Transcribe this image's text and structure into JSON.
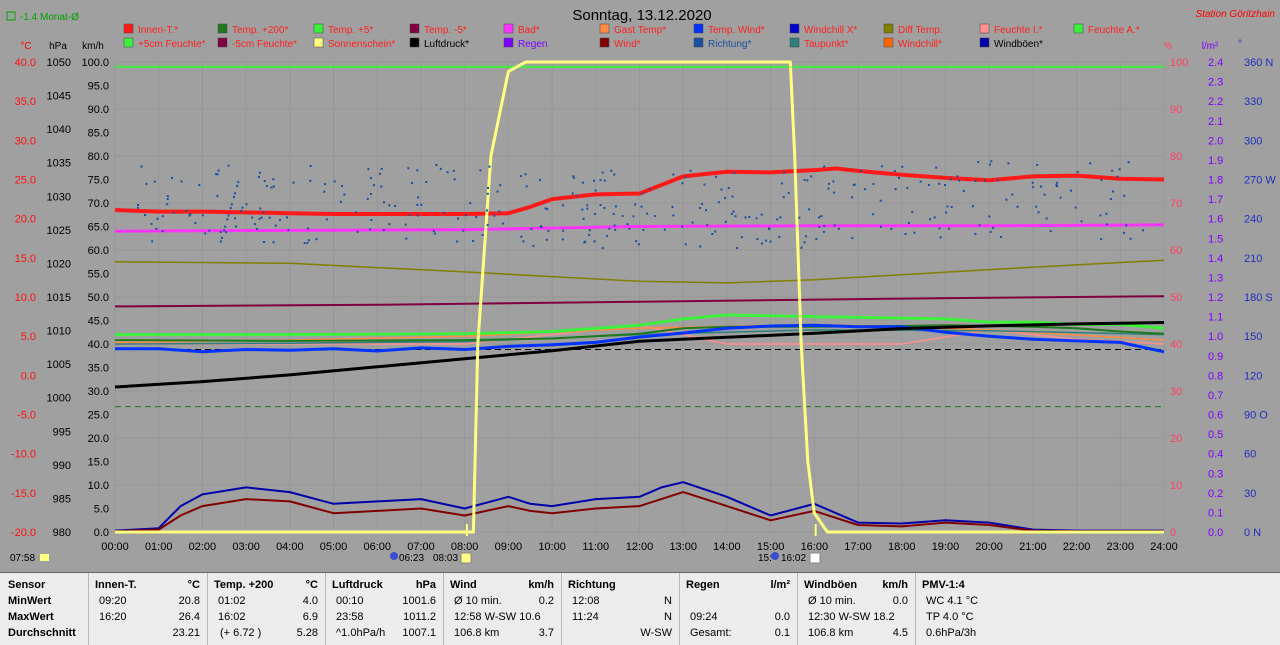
{
  "header": {
    "avg_label": "-1.4 Monat-Ø",
    "title": "Sonntag, 13.12.2020",
    "station": "Station Göritzhain"
  },
  "colors": {
    "plot_bg": "#a0a0a0",
    "innen_t": "#ff1a1a",
    "temp200": "#1f7a1f",
    "temp5": "#3cf03c",
    "temp_m5": "#800040",
    "bad": "#ff33ff",
    "gast": "#ff8c40",
    "temp_wind": "#0033ff",
    "windchill_x": "#0000cc",
    "diff_temp": "#808000",
    "feuchte_i": "#ff9090",
    "feuchte_a": "#3cf03c",
    "sonnenschein": "#ffff80",
    "luftdruck": "#000000",
    "regen": "#8000ff",
    "wind": "#800000",
    "richtung": "#1a4fa0",
    "taupunkt": "#2f7f7f",
    "windchill": "#ff6600",
    "windboeen": "#0000aa"
  },
  "legend": [
    {
      "label": "Innen-T.*",
      "color": "#ff1a1a",
      "text_color": "#ff2020"
    },
    {
      "label": "Temp. +200*",
      "color": "#1f7a1f",
      "text_color": "#ff2020"
    },
    {
      "label": "Temp. +5*",
      "color": "#3cf03c",
      "text_color": "#ff2020"
    },
    {
      "label": "Temp. -5*",
      "color": "#800040",
      "text_color": "#ff2020"
    },
    {
      "label": "Bad*",
      "color": "#ff33ff",
      "text_color": "#ff2020"
    },
    {
      "label": "Gast Temp*",
      "color": "#ff8c40",
      "text_color": "#ff2020"
    },
    {
      "label": "Temp. Wind*",
      "color": "#0033ff",
      "text_color": "#ff2020"
    },
    {
      "label": "Windchill X*",
      "color": "#0000cc",
      "text_color": "#ff2020"
    },
    {
      "label": "Diff Temp.",
      "color": "#808000",
      "text_color": "#ff2020"
    },
    {
      "label": "Feuchte I.*",
      "color": "#ff9090",
      "text_color": "#ff2020"
    },
    {
      "label": "Feuchte A.*",
      "color": "#3cf03c",
      "text_color": "#ff2020"
    },
    {
      "label": "+5cm Feuchte*",
      "color": "#3cf03c",
      "text_color": "#ff2020"
    },
    {
      "label": "-5cm Feuchte*",
      "color": "#800040",
      "text_color": "#ff2020"
    },
    {
      "label": "Sonnenschein*",
      "color": "#ffff80",
      "text_color": "#ff2020"
    },
    {
      "label": "Luftdruck*",
      "color": "#000000",
      "text_color": "#000000"
    },
    {
      "label": "Regen",
      "color": "#8000ff",
      "text_color": "#8000ff"
    },
    {
      "label": "Wind*",
      "color": "#800000",
      "text_color": "#ff2020"
    },
    {
      "label": "Richtung*",
      "color": "#1a4fa0",
      "text_color": "#1a4fa0"
    },
    {
      "label": "Taupunkt*",
      "color": "#2f7f7f",
      "text_color": "#ff2020"
    },
    {
      "label": "Windchill*",
      "color": "#ff6600",
      "text_color": "#ff2020"
    },
    {
      "label": "Windböen*",
      "color": "#0000aa",
      "text_color": "#000000"
    }
  ],
  "chart_data": {
    "type": "line",
    "axes": {
      "temp": {
        "unit": "°C",
        "ticks": [
          "40.0",
          "35.0",
          "30.0",
          "25.0",
          "20.0",
          "15.0",
          "10.0",
          "5.0",
          "0.0",
          "-5.0",
          "-10.0",
          "-15.0",
          "-20.0"
        ],
        "min": -20,
        "max": 40
      },
      "pressure": {
        "unit": "hPa",
        "ticks": [
          "1050",
          "1045",
          "1040",
          "1035",
          "1030",
          "1025",
          "1020",
          "1015",
          "1010",
          "1005",
          "1000",
          "995",
          "990",
          "985",
          "980"
        ],
        "min": 980,
        "max": 1050
      },
      "wind": {
        "unit": "km/h",
        "ticks": [
          "100.0",
          "95.0",
          "90.0",
          "85.0",
          "80.0",
          "75.0",
          "70.0",
          "65.0",
          "60.0",
          "55.0",
          "50.0",
          "45.0",
          "40.0",
          "35.0",
          "30.0",
          "25.0",
          "20.0",
          "15.0",
          "10.0",
          "5.0",
          "0.0"
        ],
        "min": 0,
        "max": 100
      },
      "humidity": {
        "unit": "%",
        "ticks": [
          "100",
          "90",
          "80",
          "70",
          "60",
          "50",
          "40",
          "30",
          "20",
          "10",
          "0"
        ],
        "min": 0,
        "max": 100
      },
      "rain": {
        "unit": "l/m²",
        "ticks": [
          "2.4",
          "2.3",
          "2.2",
          "2.1",
          "2.0",
          "1.9",
          "1.8",
          "1.7",
          "1.6",
          "1.5",
          "1.4",
          "1.3",
          "1.2",
          "1.1",
          "1.0",
          "0.9",
          "0.8",
          "0.7",
          "0.6",
          "0.5",
          "0.4",
          "0.3",
          "0.2",
          "0.1",
          "0.0"
        ],
        "min": 0,
        "max": 2.4
      },
      "direction": {
        "unit": "°",
        "ticks": [
          "360 N",
          "330",
          "300",
          "270 W",
          "240",
          "210",
          "180 S",
          "150",
          "120",
          "90 O",
          "60",
          "30",
          "0 N"
        ],
        "min": 0,
        "max": 360
      },
      "time": {
        "ticks": [
          "00:00",
          "01:00",
          "02:00",
          "03:00",
          "04:00",
          "05:00",
          "06:00",
          "07:00",
          "08:00",
          "09:00",
          "10:00",
          "11:00",
          "12:00",
          "13:00",
          "14:00",
          "15:00",
          "16:00",
          "17:00",
          "18:00",
          "19:00",
          "20:00",
          "21:00",
          "22:00",
          "23:00",
          "24:00"
        ],
        "min": 0,
        "max": 24
      }
    },
    "markers": {
      "left": "07:58",
      "sunrise": "06:23",
      "civil": "08:03",
      "sunset": "15:",
      "civil_end": "16:02"
    },
    "series": [
      {
        "name": "Innen-T.*",
        "axis": "temp",
        "x": [
          0,
          1,
          2,
          3,
          4,
          5,
          6,
          7,
          8,
          9,
          9.5,
          10,
          11,
          12,
          12.5,
          13,
          14,
          15,
          16,
          16.5,
          17,
          18,
          19,
          20,
          21,
          22,
          23,
          24
        ],
        "values": [
          21.1,
          20.9,
          20.9,
          20.8,
          20.7,
          20.6,
          20.6,
          20.6,
          20.6,
          20.7,
          21.5,
          22.5,
          23.1,
          23.2,
          24.3,
          25.4,
          26.0,
          25.9,
          26.2,
          26.4,
          26.1,
          25.6,
          25.2,
          24.9,
          25.4,
          25.5,
          25.1,
          25.0
        ]
      },
      {
        "name": "Bad*",
        "axis": "temp",
        "x": [
          0,
          4,
          8,
          12,
          16,
          20,
          24
        ],
        "values": [
          18.4,
          18.5,
          18.6,
          19.0,
          19.1,
          19.1,
          19.2
        ]
      },
      {
        "name": "Diff Temp.",
        "axis": "temp",
        "x": [
          0,
          4,
          8,
          12,
          14,
          16,
          20,
          24
        ],
        "values": [
          14.5,
          14.3,
          13.2,
          12.0,
          11.8,
          12.2,
          13.5,
          14.7
        ]
      },
      {
        "name": "Temp. -5*",
        "axis": "temp",
        "x": [
          0,
          6,
          12,
          18,
          24
        ],
        "values": [
          8.8,
          9.0,
          9.4,
          9.8,
          10.1
        ]
      },
      {
        "name": "Temp. +5*",
        "axis": "temp",
        "x": [
          0,
          4,
          8,
          10,
          12,
          13,
          14,
          16,
          18,
          19,
          20,
          21,
          22,
          23,
          24
        ],
        "values": [
          5.2,
          5.2,
          5.3,
          5.6,
          6.4,
          7.2,
          7.7,
          7.5,
          7.3,
          7.2,
          6.8,
          6.8,
          6.5,
          6.5,
          6.0
        ]
      },
      {
        "name": "Temp. +200*",
        "axis": "temp",
        "x": [
          0,
          4,
          8,
          10,
          12,
          13,
          14,
          16,
          18,
          19,
          20,
          21,
          22,
          23,
          24
        ],
        "values": [
          4.5,
          4.4,
          4.5,
          4.7,
          5.3,
          6.0,
          6.2,
          6.2,
          6.3,
          6.4,
          6.3,
          6.2,
          6.0,
          5.6,
          5.3
        ]
      },
      {
        "name": "Temp. Wind*",
        "axis": "temp",
        "x": [
          0,
          1,
          2,
          3,
          4,
          5,
          6,
          7,
          8,
          9,
          10,
          11,
          12,
          13,
          14,
          15,
          16,
          17,
          18,
          19,
          20,
          21,
          22,
          23,
          24
        ],
        "values": [
          3.4,
          3.4,
          3.0,
          3.3,
          3.2,
          3.4,
          3.1,
          3.5,
          3.3,
          3.7,
          3.9,
          4.2,
          4.9,
          5.4,
          6.0,
          6.3,
          6.4,
          6.2,
          6.2,
          5.5,
          5.0,
          4.6,
          4.4,
          4.2,
          3.0
        ]
      },
      {
        "name": "Gast Temp*",
        "axis": "temp",
        "x": [
          0,
          4,
          8,
          12,
          16,
          20,
          24
        ],
        "values": [
          4.2,
          4.5,
          5.0,
          6.0,
          6.5,
          5.8,
          4.5
        ]
      },
      {
        "name": "Taupunkt*",
        "axis": "temp",
        "x": [
          0,
          4,
          8,
          12,
          16,
          20,
          24
        ],
        "values": [
          4.0,
          4.1,
          4.3,
          5.2,
          5.8,
          5.7,
          5.2
        ]
      },
      {
        "name": "Feuchte I.*",
        "axis": "humidity",
        "x": [
          0,
          4,
          8,
          10,
          12,
          13,
          14,
          16,
          18,
          20,
          21,
          22,
          24
        ],
        "values": [
          40,
          40,
          40,
          42,
          44,
          42,
          40,
          40,
          40,
          43,
          42,
          41,
          40
        ]
      },
      {
        "name": "Luftdruck*",
        "axis": "pressure",
        "x": [
          0,
          2,
          4,
          6,
          8,
          10,
          12,
          14,
          16,
          18,
          20,
          22,
          24
        ],
        "values": [
          1001.6,
          1002.4,
          1003.4,
          1004.6,
          1005.8,
          1007.0,
          1008.4,
          1009.0,
          1009.6,
          1010.3,
          1010.7,
          1011.0,
          1011.2
        ]
      },
      {
        "name": "Wind*",
        "axis": "wind",
        "x": [
          0,
          1,
          1.5,
          2,
          3,
          4,
          5,
          6,
          7,
          8,
          9,
          9.5,
          10,
          11,
          12,
          12.5,
          13,
          14,
          15,
          16,
          17,
          18,
          19,
          20,
          21,
          22,
          23,
          24
        ],
        "values": [
          0.2,
          0.5,
          3.5,
          5.5,
          7.0,
          6.5,
          4.0,
          4.5,
          5.0,
          3.5,
          5.5,
          4.5,
          4.0,
          5.0,
          5.5,
          7.0,
          8.5,
          5.5,
          2.5,
          4.5,
          1.5,
          1.2,
          2.0,
          1.5,
          0.3,
          0.2,
          0.2,
          0.2
        ]
      },
      {
        "name": "Windböen*",
        "axis": "wind",
        "x": [
          0,
          1,
          1.5,
          2,
          3,
          4,
          5,
          6,
          7,
          8,
          9,
          9.5,
          10,
          11,
          12,
          12.5,
          13,
          14,
          15,
          16,
          17,
          18,
          19,
          20,
          21,
          22,
          23,
          24
        ],
        "values": [
          0.3,
          0.8,
          5.5,
          8.0,
          9.5,
          8.5,
          6.0,
          6.5,
          7.0,
          5.0,
          7.5,
          6.0,
          5.5,
          7.0,
          7.5,
          9.5,
          10.6,
          7.5,
          3.5,
          6.0,
          2.0,
          1.8,
          2.5,
          2.0,
          0.5,
          0.3,
          0.3,
          0.3
        ]
      },
      {
        "name": "Sonnenschein*",
        "axis": "humidity",
        "x": [
          0,
          8.2,
          8.3,
          8.6,
          9.0,
          9.4,
          15.3,
          15.45,
          15.55,
          15.7,
          15.85,
          16.0,
          16.3,
          24
        ],
        "values": [
          0,
          0,
          40,
          80,
          98,
          100,
          100,
          100,
          80,
          40,
          15,
          4,
          0,
          0
        ]
      }
    ],
    "reference_lines": [
      {
        "axis": "temp",
        "value": -4.0,
        "style": "dashed",
        "color": "#1f7a1f"
      },
      {
        "axis": "temp",
        "value": 3.3,
        "style": "dashed",
        "color": "#000000"
      },
      {
        "axis": "humidity",
        "value": 99,
        "style": "solid",
        "color": "#3cf03c"
      }
    ]
  },
  "stats": {
    "row_labels": [
      "Sensor",
      "MinWert",
      "MaxWert",
      "Durchschnitt"
    ],
    "sections": [
      {
        "title": "Innen-T.",
        "unit": "°C",
        "rows": [
          [
            "09:20",
            "20.8"
          ],
          [
            "16:20",
            "26.4"
          ],
          [
            "",
            "23.21"
          ]
        ]
      },
      {
        "title": "Temp. +200",
        "unit": "°C",
        "rows": [
          [
            "01:02",
            "4.0"
          ],
          [
            "16:02",
            "6.9"
          ],
          [
            "(+ 6.72 )",
            "5.28"
          ]
        ]
      },
      {
        "title": "Luftdruck",
        "unit": "hPa",
        "rows": [
          [
            "00:10",
            "1001.6"
          ],
          [
            "23:58",
            "1011.2"
          ],
          [
            "^1.0hPa/h",
            "1007.1"
          ]
        ]
      },
      {
        "title": "Wind",
        "unit": "km/h",
        "rows": [
          [
            "Ø 10 min.",
            "0.2"
          ],
          [
            "12:58   W-SW 10.6",
            ""
          ],
          [
            "106.8 km",
            "3.7"
          ]
        ]
      },
      {
        "title": "Richtung",
        "unit": "",
        "rows": [
          [
            "12:08",
            "N"
          ],
          [
            "11:24",
            "N"
          ],
          [
            "",
            "W-SW"
          ]
        ]
      },
      {
        "title": "Regen",
        "unit": "l/m²",
        "rows": [
          [
            "",
            ""
          ],
          [
            "09:24",
            "0.0"
          ],
          [
            "Gesamt:",
            "0.1"
          ]
        ]
      },
      {
        "title": "Windböen",
        "unit": "km/h",
        "rows": [
          [
            "Ø 10 min.",
            "0.0"
          ],
          [
            "12:30   W-SW 18.2",
            ""
          ],
          [
            "106.8 km",
            "4.5"
          ]
        ]
      },
      {
        "title": "PMV-1:4",
        "unit": "",
        "rows": [
          [
            "WC 4.1 °C",
            ""
          ],
          [
            "TP 4.0 °C",
            ""
          ],
          [
            "0.6hPa/3h",
            ""
          ]
        ]
      }
    ]
  }
}
